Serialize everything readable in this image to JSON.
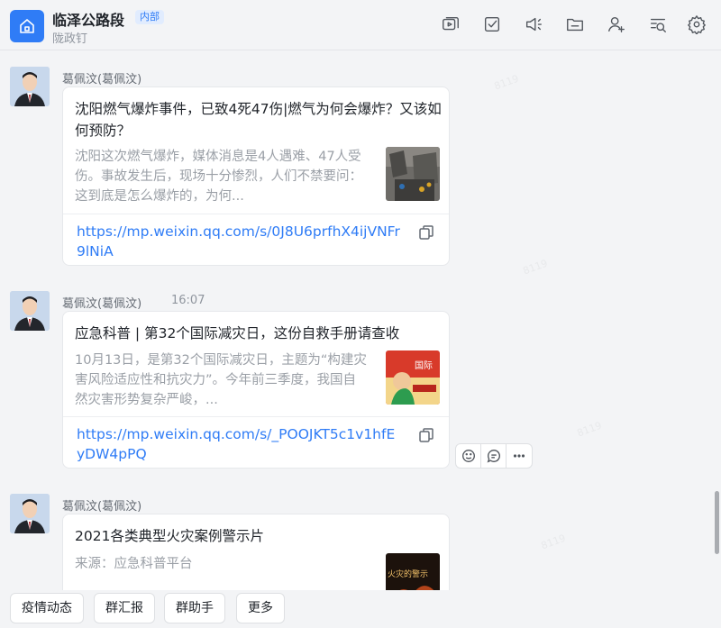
{
  "header": {
    "title": "临泽公路段",
    "tag": "内部",
    "subtitle": "陇政钉",
    "icons": [
      "video-icon",
      "todo-check-icon",
      "announcement-icon",
      "folder-icon",
      "add-member-icon",
      "search-list-icon",
      "settings-icon"
    ]
  },
  "messages": [
    {
      "sender": "葛佩汶(葛佩汶)",
      "time": "",
      "card": {
        "title": "沈阳燃气爆炸事件，已致4死47伤|燃气为何会爆炸？又该如何预防？",
        "desc": "沈阳这次燃气爆炸，媒体消息是4人遇难、47人受伤。事故发生后，现场十分惨烈，人们不禁要问：这到底是怎么爆炸的，为何...",
        "link": "https://mp.weixin.qq.com/s/0J8U6prfhX4ijVNFr9lNiA"
      }
    },
    {
      "sender": "葛佩汶(葛佩汶)",
      "time": "16:07",
      "card": {
        "title": "应急科普 | 第32个国际减灾日，这份自救手册请查收",
        "desc": "10月13日，是第32个国际减灾日，主题为“构建灾害风险适应性和抗灾力”。今年前三季度，我国自然灾害形势复杂严峻，...",
        "link": "https://mp.weixin.qq.com/s/_POOJKT5c1v1hfEyDW4pPQ",
        "thumb_text": "国际"
      }
    },
    {
      "sender": "葛佩汶(葛佩汶)",
      "time": "",
      "card": {
        "title": "2021各类典型火灾案例警示片",
        "desc": "来源：应急科普平台",
        "thumb_text": "火灾的警示"
      }
    }
  ],
  "reactions": [
    "emoji-icon",
    "reply-icon",
    "more-icon"
  ],
  "quick_actions": [
    "疫情动态",
    "群汇报",
    "群助手",
    "更多"
  ],
  "watermark": "8119",
  "colors": {
    "accent": "#2f7cf6",
    "background": "#f3f4f6"
  }
}
